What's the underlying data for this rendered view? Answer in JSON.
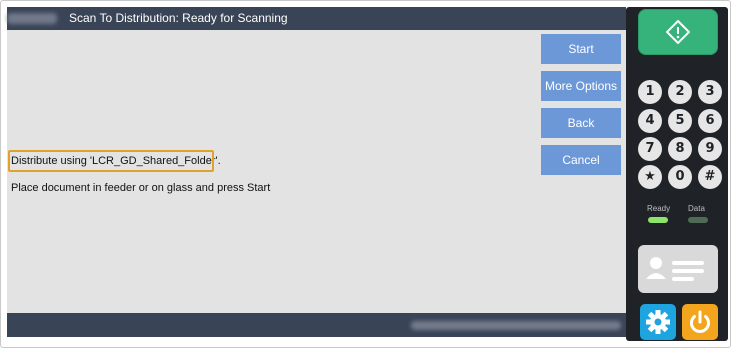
{
  "header": {
    "title": "Scan To Distribution: Ready for Scanning"
  },
  "buttons": {
    "start": "Start",
    "more_options": "More Options",
    "back": "Back",
    "cancel": "Cancel"
  },
  "messages": {
    "distribute": "Distribute using 'LCR_GD_Shared_Folder'.",
    "instruction": "Place document in feeder or on glass and press Start"
  },
  "keypad": {
    "keys": [
      "1",
      "2",
      "3",
      "4",
      "5",
      "6",
      "7",
      "8",
      "9",
      "★",
      "0",
      "#"
    ]
  },
  "indicators": {
    "ready": "Ready",
    "data": "Data"
  },
  "colors": {
    "titlebar": "#3a4457",
    "button": "#6d98d8",
    "highlight": "#e2a12a",
    "start_key": "#35b37a",
    "ready_led": "#8ee36a",
    "data_led": "#4f6b55",
    "settings": "#1ea5e0",
    "power": "#f2a51d"
  },
  "icons": {
    "start_key": "diamond-start-icon",
    "contact": "contact-card-icon",
    "settings": "gear-icon",
    "power": "power-icon"
  }
}
